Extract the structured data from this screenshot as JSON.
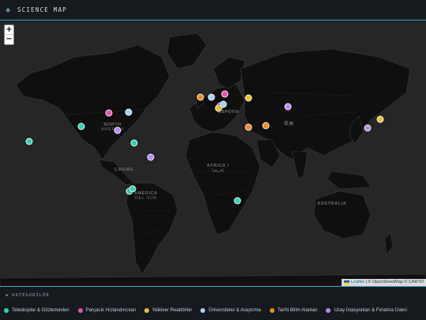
{
  "header": {
    "title": "SCIENCE MAP",
    "logo_icon": "globe-icon"
  },
  "zoom": {
    "in_label": "+",
    "out_label": "−"
  },
  "map_labels": {
    "north_america": "NORTH",
    "north_america_2": "AMERICA",
    "south_america": "AMERICA",
    "south_america_sub": "DEL SUR",
    "africa": "AFRICA /",
    "africa_sub": "إفريقيا",
    "australia": "AUSTRALIA",
    "asia": "亚洲",
    "europe": "ЕВРОПА",
    "caribbean": "CARIBE"
  },
  "attribution": {
    "leaflet": "Leaflet",
    "rest": "| © OpenStreetMap © CARTO"
  },
  "legend": {
    "title": "KATEGORİLER",
    "items": [
      {
        "label": "Teleskoplar & Gözlemevleri",
        "color": "#2ed3b7"
      },
      {
        "label": "Parçacık Hızlandırıcıları",
        "color": "#e84fb0"
      },
      {
        "label": "Nükleer Reaktörler",
        "color": "#f2c12e"
      },
      {
        "label": "Üniversiteler & Araştırma",
        "color": "#9fd2f5"
      },
      {
        "label": "Tarihi Bilim Alanları",
        "color": "#f08c1e"
      },
      {
        "label": "Uzay İstasyonları & Fırlatma Üsleri",
        "color": "#b98af0"
      }
    ]
  },
  "markers": [
    {
      "category": "Teleskoplar & Gözlemevleri",
      "color": "#2ed3b7",
      "lat": 31.9,
      "lon": -111.6
    },
    {
      "category": "Teleskoplar & Gözlemevleri",
      "color": "#2ed3b7",
      "lat": 19.8,
      "lon": -155.5
    },
    {
      "category": "Teleskoplar & Gözlemevleri",
      "color": "#2ed3b7",
      "lat": 18.3,
      "lon": -66.8
    },
    {
      "category": "Teleskoplar & Gözlemevleri",
      "color": "#2ed3b7",
      "lat": -24.6,
      "lon": -70.4
    },
    {
      "category": "Teleskoplar & Gözlemevleri",
      "color": "#2ed3b7",
      "lat": -23.0,
      "lon": -68.0
    },
    {
      "category": "Teleskoplar & Gözlemevleri",
      "color": "#2ed3b7",
      "lat": -32.4,
      "lon": 20.8
    },
    {
      "category": "Parçacık Hızlandırıcıları",
      "color": "#e84fb0",
      "lat": 41.8,
      "lon": -88.3
    },
    {
      "category": "Parçacık Hızlandırıcıları",
      "color": "#e84fb0",
      "lat": 53.6,
      "lon": 9.9
    },
    {
      "category": "Parçacık Hızlandırıcıları",
      "color": "#e84fb0",
      "lat": 46.2,
      "lon": 6.1
    },
    {
      "category": "Nükleer Reaktörler",
      "color": "#f2c12e",
      "lat": 51.4,
      "lon": 30.1
    },
    {
      "category": "Nükleer Reaktörler",
      "color": "#f2c12e",
      "lat": 37.4,
      "lon": 141.0
    },
    {
      "category": "Nükleer Reaktörler",
      "color": "#f2c12e",
      "lat": 44.9,
      "lon": 4.9
    },
    {
      "category": "Üniversiteler & Araştırma",
      "color": "#9fd2f5",
      "lat": 42.4,
      "lon": -71.1
    },
    {
      "category": "Üniversiteler & Araştırma",
      "color": "#9fd2f5",
      "lat": 51.8,
      "lon": -1.3
    },
    {
      "category": "Üniversiteler & Araştırma",
      "color": "#9fd2f5",
      "lat": 47.4,
      "lon": 8.5
    },
    {
      "category": "Tarihi Bilim Alanları",
      "color": "#f08c1e",
      "lat": 51.5,
      "lon": -10.5
    },
    {
      "category": "Tarihi Bilim Alanları",
      "color": "#f08c1e",
      "lat": 31.2,
      "lon": 29.9
    },
    {
      "category": "Tarihi Bilim Alanları",
      "color": "#f08c1e",
      "lat": 32.5,
      "lon": 44.4
    },
    {
      "category": "Uzay İstasyonları & Fırlatma Üsleri",
      "color": "#b98af0",
      "lat": 28.5,
      "lon": -80.6
    },
    {
      "category": "Uzay İstasyonları & Fırlatma Üsleri",
      "color": "#b98af0",
      "lat": 5.2,
      "lon": -52.8
    },
    {
      "category": "Uzay İstasyonları & Fırlatma Üsleri",
      "color": "#b98af0",
      "lat": 45.9,
      "lon": 63.3
    },
    {
      "category": "Uzay İstasyonları & Fırlatma Üsleri",
      "color": "#b98af0",
      "lat": 30.4,
      "lon": 130.9
    }
  ]
}
